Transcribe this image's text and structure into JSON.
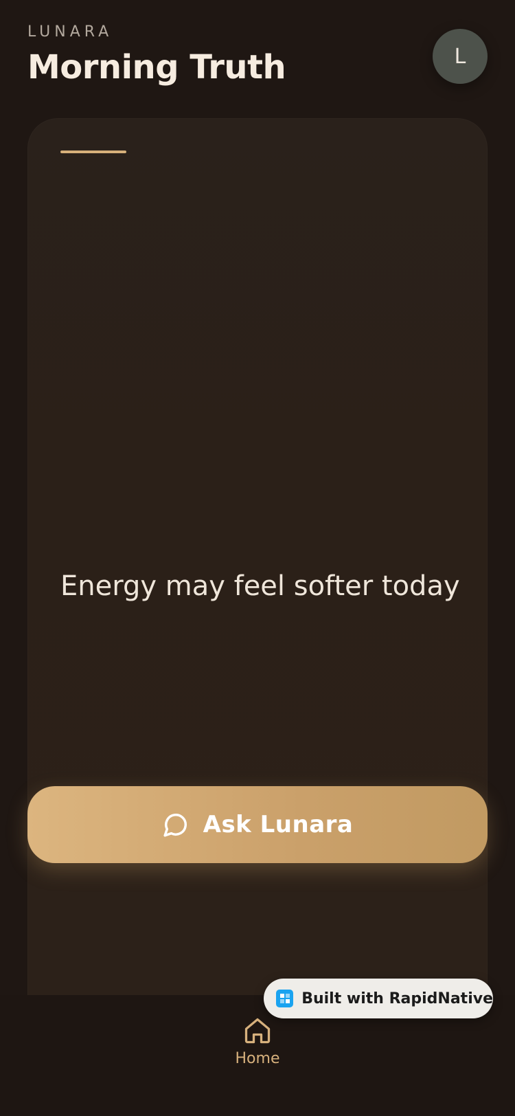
{
  "header": {
    "brand": "LUNARA",
    "title": "Morning Truth",
    "avatar_initial": "L"
  },
  "card": {
    "message": "Energy may feel softer today"
  },
  "ask_button": {
    "label": "Ask Lunara",
    "icon": "chat-bubble-icon"
  },
  "tab_bar": {
    "items": [
      {
        "label": "Home",
        "icon": "home-icon"
      }
    ]
  },
  "badge": {
    "label": "Built with RapidNative",
    "icon": "rapidnative-logo"
  },
  "colors": {
    "background": "#1f1713",
    "card": "#2b2018",
    "accent": "#d6b07a",
    "button": "#d4ab74",
    "text_primary": "#f6ece0"
  }
}
